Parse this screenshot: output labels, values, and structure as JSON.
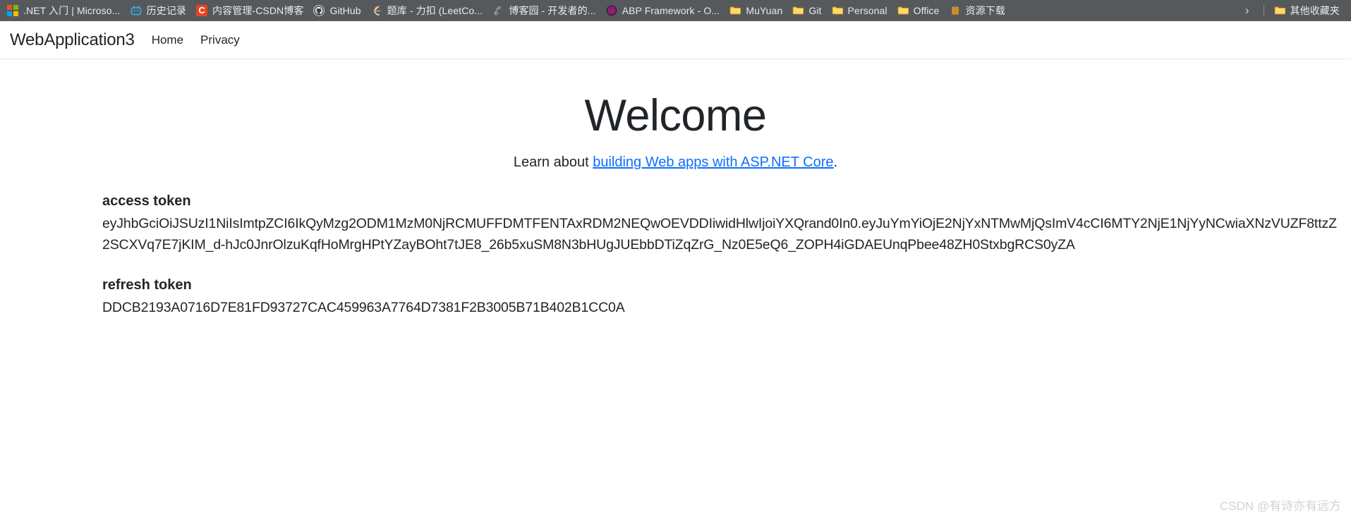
{
  "browser": {
    "bookmarks": [
      {
        "label": ".NET 入门 | Microso...",
        "icon": "microsoft-logo-icon"
      },
      {
        "label": "历史记录",
        "icon": "bilibili-icon"
      },
      {
        "label": "内容管理-CSDN博客",
        "icon": "csdn-icon"
      },
      {
        "label": "GitHub",
        "icon": "github-icon"
      },
      {
        "label": "题库 - 力扣 (LeetCo...",
        "icon": "leetcode-icon"
      },
      {
        "label": "博客园 - 开发者的...",
        "icon": "cnblogs-icon"
      },
      {
        "label": "ABP Framework - O...",
        "icon": "abp-icon"
      },
      {
        "label": "MuYuan",
        "icon": "folder-icon"
      },
      {
        "label": "Git",
        "icon": "folder-icon"
      },
      {
        "label": "Personal",
        "icon": "folder-icon"
      },
      {
        "label": "Office",
        "icon": "folder-icon"
      },
      {
        "label": "资源下载",
        "icon": "download-icon"
      }
    ],
    "overflow_chevron": "›",
    "other_bookmarks": {
      "label": "其他收藏夹",
      "icon": "folder-icon"
    }
  },
  "site": {
    "brand": "WebApplication3",
    "nav": [
      {
        "label": "Home"
      },
      {
        "label": "Privacy"
      }
    ]
  },
  "main": {
    "title": "Welcome",
    "learn_prefix": "Learn about ",
    "learn_link": "building Web apps with ASP.NET Core",
    "learn_suffix": ".",
    "access_token_label": "access token",
    "access_token_value": "eyJhbGciOiJSUzI1NiIsImtpZCI6IkQyMzg2ODM1MzM0NjRCMUFFDMTFENTAxRDM2NEQwOEVDDIiwidHlwIjoiYXQrand0In0.eyJuYmYiOjE2NjYxNTMwMjQsImV4cCI6MTY2NjE1NjYyNCwiaXNzVUZF8ttzZ2SCXVq7E7jKIM_d-hJc0JnrOlzuKqfHoMrgHPtYZayBOht7tJE8_26b5xuSM8N3bHUgJUEbbDTiZqZrG_Nz0E5eQ6_ZOPH4iGDAEUnqPbee48ZH0StxbgRCS0yZA",
    "refresh_token_label": "refresh token",
    "refresh_token_value": "DDCB2193A0716D7E81FD93727CAC459963A7764D7381F2B3005B71B402B1CC0A"
  },
  "watermark": "CSDN @有诗亦有远方",
  "colors": {
    "bookmarks_bar_bg": "#56595c",
    "link_blue": "#0d6efd",
    "text_dark": "#212529"
  }
}
